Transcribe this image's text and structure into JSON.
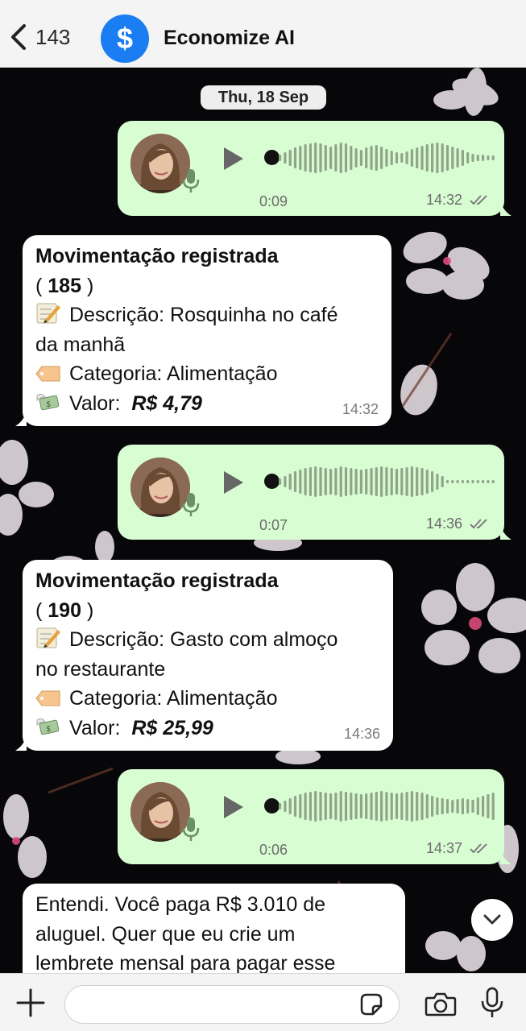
{
  "header": {
    "back_count": "143",
    "title": "Economize AI",
    "logo_symbol": "$",
    "accent": "#1a7df2"
  },
  "date_label": "Thu, 18 Sep",
  "voice_messages": [
    {
      "duration": "0:09",
      "time": "14:32",
      "status_icon": "double-check-icon"
    },
    {
      "duration": "0:07",
      "time": "14:36",
      "status_icon": "double-check-icon"
    },
    {
      "duration": "0:06",
      "time": "14:37",
      "status_icon": "double-check-icon"
    }
  ],
  "records": [
    {
      "title": "Movimentação registrada",
      "id_prefix": "( ",
      "id": "185",
      "id_suffix": " )",
      "desc_line1": "Descrição: Rosquinha no café",
      "desc_line2": "da manhã",
      "category": "Categoria: Alimentação",
      "value_label": "Valor:",
      "value": "R$ 4,79",
      "time": "14:32"
    },
    {
      "title": "Movimentação registrada",
      "id_prefix": "( ",
      "id": "190",
      "id_suffix": " )",
      "desc_line1": "Descrição: Gasto com almoço",
      "desc_line2": "no restaurante",
      "category": "Categoria: Alimentação",
      "value_label": "Valor:",
      "value": "R$ 25,99",
      "time": "14:36"
    }
  ],
  "last_message": {
    "line1": "Entendi. Você paga R$ 3.010 de",
    "line2": "aluguel. Quer que eu crie um",
    "line3": "lembrete mensal para pagar esse"
  },
  "composer": {
    "placeholder": ""
  },
  "colors": {
    "outgoing_bubble": "#d9fdd3",
    "incoming_bubble": "#ffffff",
    "bars": "#8fa58a"
  }
}
